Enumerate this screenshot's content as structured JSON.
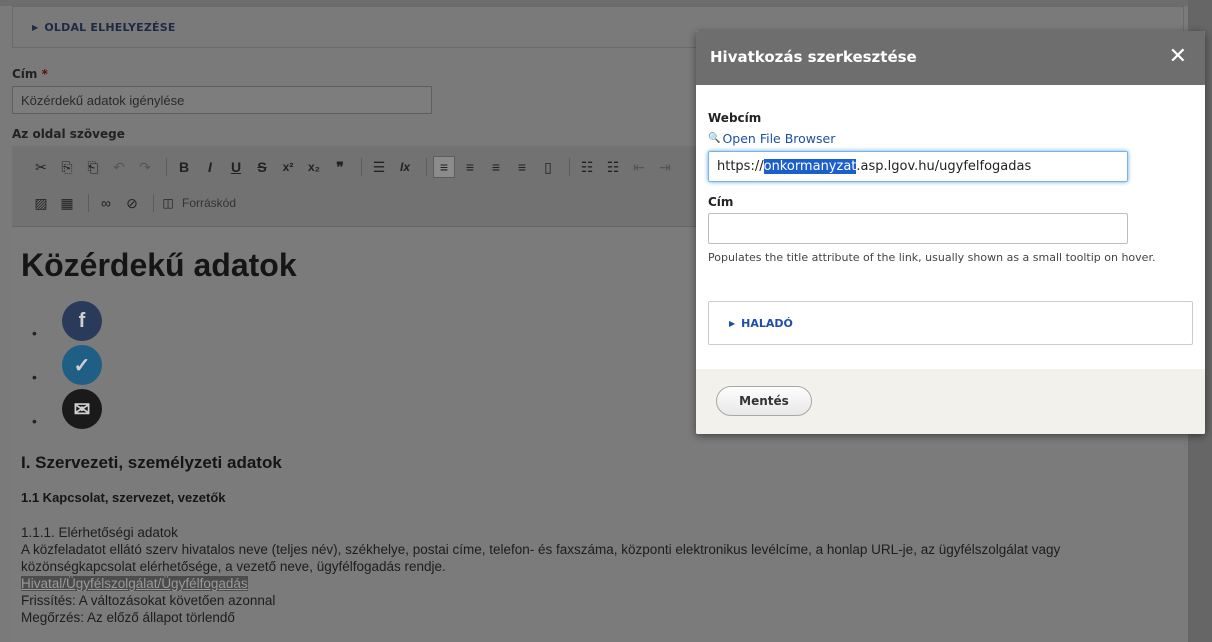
{
  "page": {
    "details_summary": "OLDAL ELHELYEZÉSE",
    "title_label": "Cím",
    "required_mark": "*",
    "title_value": "Közérdekű adatok igénylése",
    "body_label": "Az oldal szövege",
    "toolbar": {
      "cut": "✂",
      "copy": "⎘",
      "paste": "⎗",
      "undo": "↶",
      "redo": "↷",
      "bold": "B",
      "italic": "I",
      "underline": "U",
      "strike": "S",
      "sup": "x²",
      "sub": "x₂",
      "quote": "❞",
      "hr": "☰",
      "clear_format": "Ix",
      "align_left": "≡",
      "align_center": "≡",
      "align_right": "≡",
      "justify": "≡",
      "show_blocks": "▯",
      "bullet_list": "☷",
      "numbered_list": "☷",
      "outdent": "⇤",
      "indent": "⇥",
      "image": "▨",
      "table": "▦",
      "link": "∞",
      "unlink": "⊘",
      "source_icon": "◫",
      "source_label": "Forráskód"
    },
    "content": {
      "h1": "Közérdekű adatok",
      "social": [
        {
          "glyph": "f",
          "color": "#2a3a5a"
        },
        {
          "glyph": "✓",
          "color": "#1f5f86"
        },
        {
          "glyph": "✉",
          "color": "#1a1a1a"
        }
      ],
      "bullet": "•",
      "h2": "I. Szervezeti, személyzeti adatok",
      "h3": "1.1 Kapcsolat, szervezet, vezetők",
      "p1": "1.1.1. Elérhetőségi adatok",
      "p2": "A közfeladatot ellátó szerv hivatalos neve (teljes név), székhelye, postai címe, telefon- és faxszáma, központi elektronikus levélcíme, a honlap URL-je, az ügyfélszolgálat vagy",
      "p3": "közönségkapcsolat elérhetősége, a vezető neve, ügyfélfogadás rendje.",
      "p4_link": "Hivatal/Ügyfélszolgálat/Ügyfélfogadás",
      "p5": "Frissítés: A változásokat követően azonnal",
      "p6": "Megőrzés: Az előző állapot törlendő"
    }
  },
  "dialog": {
    "title": "Hivatkozás szerkesztése",
    "close": "✕",
    "url_label": "Webcím",
    "browse_icon": "🔍",
    "browse_link": "Open File Browser",
    "url_prefix": "https://",
    "url_selected": "onkormanyzat",
    "url_suffix": ".asp.lgov.hu/ugyfelfogadas",
    "title_label": "Cím",
    "title_value": "",
    "help": "Populates the title attribute of the link, usually shown as a small tooltip on hover.",
    "advanced": "HALADÓ",
    "save": "Mentés"
  }
}
